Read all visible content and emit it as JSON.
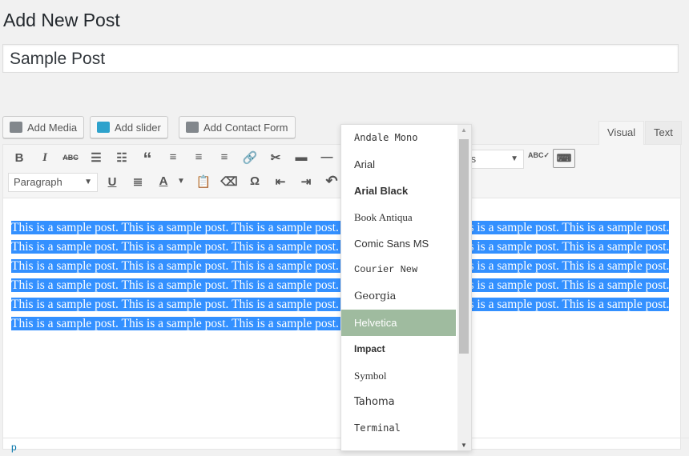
{
  "page_title": "Add New Post",
  "post_title": "Sample Post",
  "media_buttons": [
    "Add Media",
    "Add slider",
    "Add Contact Form"
  ],
  "tabs": {
    "visual": "Visual",
    "text": "Text"
  },
  "toolbar": {
    "format_select": "Paragraph",
    "font_sizes": "Font Sizes",
    "font_sizes_visible": "izes"
  },
  "content": "This is a sample post. This is a sample post. This is a sample post. This is a sample post. This is a sample post. This is a sample post. This is a sample post. This is a sample post. This is a sample post. This is a sample post. This is a sample post. This is a sample post. This is a sample post. This is a sample post. This is a sample post. This is a sample post. This is a sample post. This is a sample post. This is a sample post. This is a sample post. This is a sample post. This is a sample post. This is a sample post. This is a sample post. This is a sample post. This is a sample post. This is a sample post. This is a sample post. This is a sample post. This is a sample post. This is a sample post. This is a sample post. This is a sample post. This is a sample post.",
  "status_path": "p",
  "font_dropdown": {
    "selected": "Helvetica",
    "items": [
      "Andale Mono",
      "Arial",
      "Arial Black",
      "Book Antiqua",
      "Comic Sans MS",
      "Courier New",
      "Georgia",
      "Helvetica",
      "Impact",
      "Symbol",
      "Tahoma",
      "Terminal"
    ]
  },
  "colors": {
    "selection": "#3390ff",
    "dropdown_highlight": "#9fbb9f"
  }
}
